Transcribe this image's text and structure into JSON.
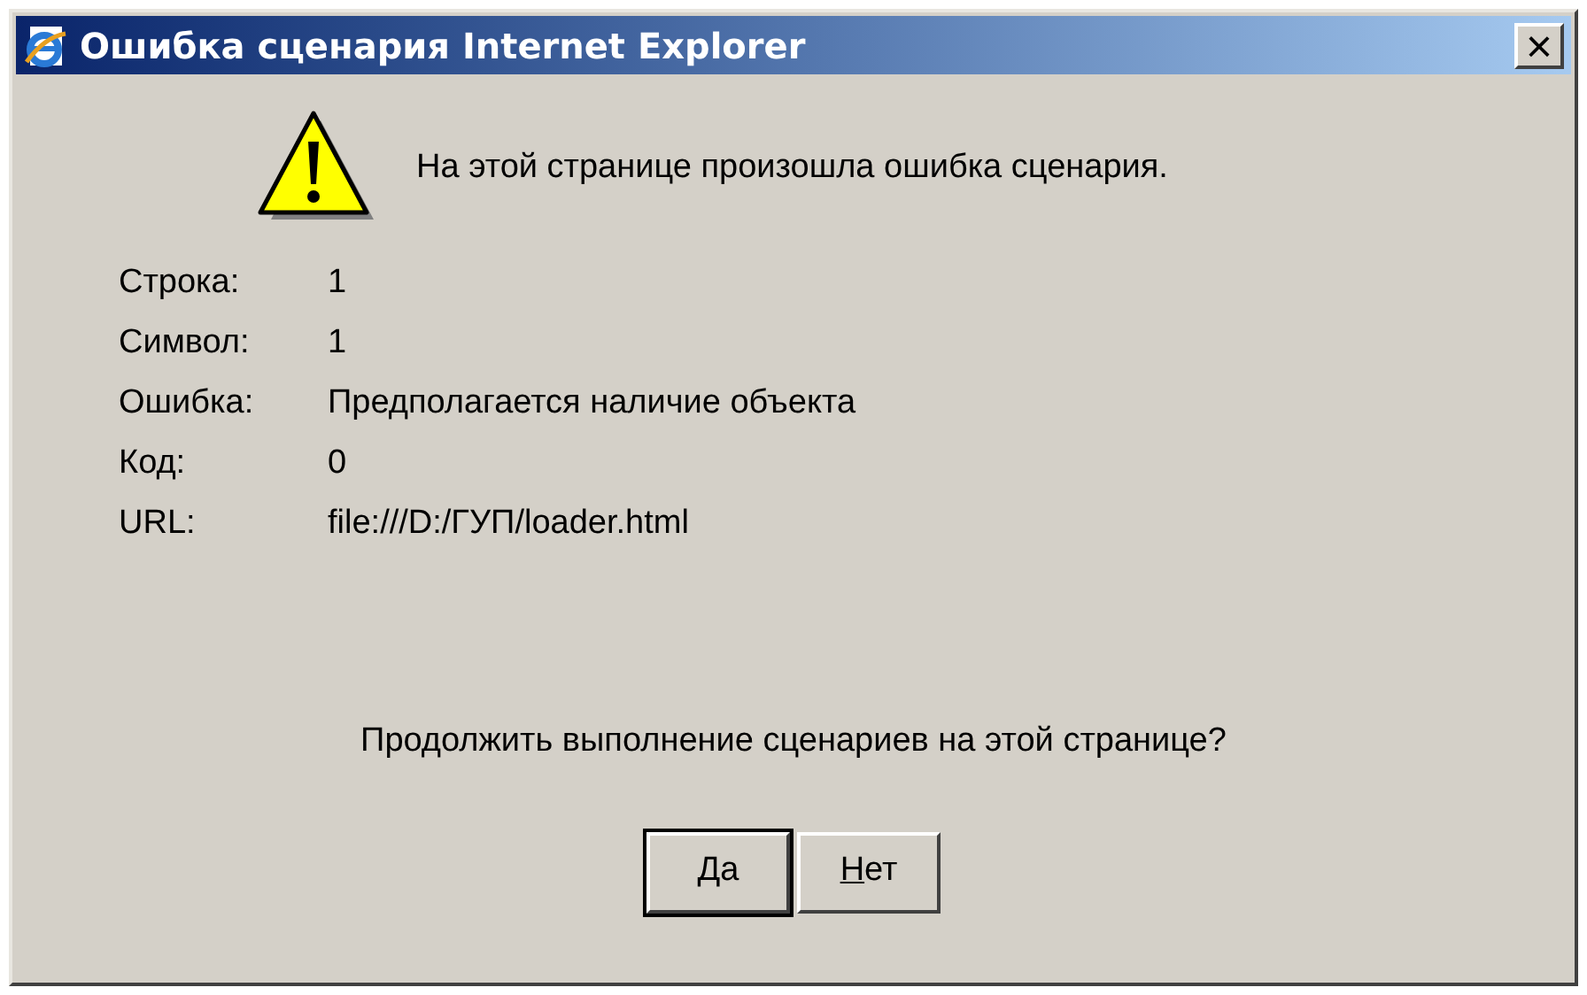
{
  "window": {
    "title": "Ошибка сценария Internet Explorer",
    "close": "×"
  },
  "message": "На этой странице произошла ошибка сценария.",
  "details": [
    {
      "label": "Строка:",
      "value": "1"
    },
    {
      "label": "Символ:",
      "value": "1"
    },
    {
      "label": "Ошибка:",
      "value": "Предполагается наличие объекта"
    },
    {
      "label": "Код:",
      "value": "0"
    },
    {
      "label": "URL:",
      "value": "file:///D:/ГУП/loader.html"
    }
  ],
  "question": "Продолжить выполнение сценариев на этой странице?",
  "buttons": [
    {
      "label": "Да",
      "default": true
    },
    {
      "label": "Нет",
      "default": false
    }
  ]
}
